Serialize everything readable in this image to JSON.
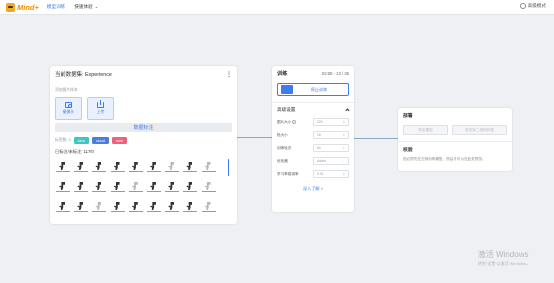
{
  "header": {
    "logo_text": "Mind+",
    "nav": [
      {
        "label": "模型训练",
        "active": true
      },
      {
        "label": "快速体验",
        "active": false
      }
    ],
    "advanced_mode_label": "高级模式"
  },
  "dataset": {
    "title": "当前数据集: Experience",
    "subtitle": "添加图片样本",
    "capture_label": "摄像头",
    "upload_label": "上传",
    "annotate_label": "数据标注",
    "labels_prefix": "标签数: 3",
    "tags": [
      {
        "label": "dino",
        "color": "#3ec6c1"
      },
      {
        "label": "cloud",
        "color": "#4a7de0"
      },
      {
        "label": "rock",
        "color": "#f0607a"
      }
    ],
    "count_text": "已标注/未标注: 117/0"
  },
  "train": {
    "title": "训练",
    "date": "02:08 - 13 / 36",
    "button_label": "停止训练",
    "advanced_label": "高级设置",
    "params": [
      {
        "label": "图片大小",
        "value": "224",
        "info": true
      },
      {
        "label": "批大小",
        "value": "16",
        "info": false
      },
      {
        "label": "训练轮次",
        "value": "50",
        "info": false
      },
      {
        "label": "优化器",
        "value": "Adam",
        "info": false
      },
      {
        "label": "学习率衰减率",
        "value": "0.01",
        "info": false
      }
    ],
    "more_label": "深入了解"
  },
  "deploy": {
    "title": "部署",
    "btn1_label": "导出模型",
    "btn2_label": "发布到二维码列表",
    "verify_title": "校验",
    "verify_desc": "您必须先在左侧训练模型，然后才可以在此处预览。"
  },
  "watermark": {
    "title": "激活 Windows",
    "sub": "转到\"设置\"以激活 Windows。"
  },
  "colors": {
    "accent": "#3d7cf0",
    "brand": "#f08c00"
  }
}
